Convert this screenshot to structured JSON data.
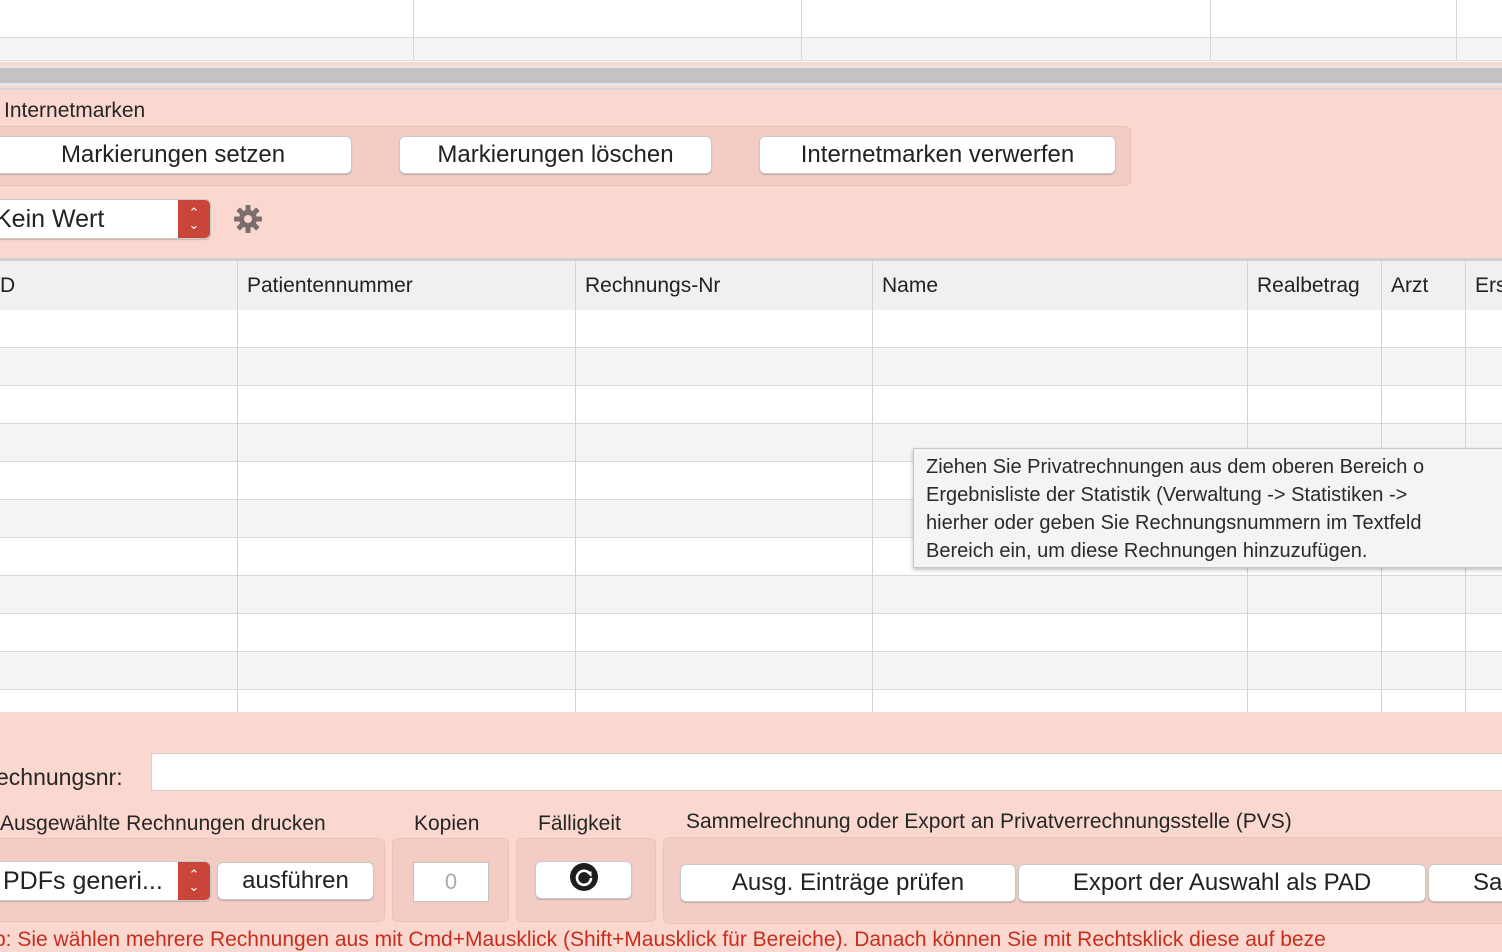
{
  "internetmarken": {
    "section_label": "Internetmarken",
    "set_button": "Markierungen setzen",
    "delete_button": "Markierungen löschen",
    "discard_button": "Internetmarken verwerfen"
  },
  "filter": {
    "selected": "Kein Wert"
  },
  "table": {
    "columns": [
      "D",
      "Patientennummer",
      "Rechnungs-Nr",
      "Name",
      "Realbetrag",
      "Arzt",
      "Ers"
    ]
  },
  "tooltip": {
    "lines": [
      "Ziehen Sie Privatrechnungen aus dem oberen Bereich o",
      "Ergebnisliste der Statistik (Verwaltung -> Statistiken ->",
      "hierher oder geben Sie Rechnungsnummern im Textfeld",
      "Bereich ein, um diese Rechnungen hinzuzufügen."
    ]
  },
  "rechnungsnr": {
    "label": "echnungsnr:",
    "value": ""
  },
  "print": {
    "group_label": "Ausgewählte Rechnungen drucken",
    "selected_option": "PDFs generi...",
    "run_button": "ausführen"
  },
  "kopien": {
    "label": "Kopien",
    "placeholder": "0"
  },
  "faelligkeit": {
    "label": "Fälligkeit"
  },
  "pvs": {
    "group_label": "Sammelrechnung oder Export an Privatverrechnungsstelle (PVS)",
    "check_button": "Ausg. Einträge prüfen",
    "export_button": "Export der Auswahl als PAD",
    "third_button": "Sa"
  },
  "hint": "p: Sie wählen mehrere Rechnungen aus mit Cmd+Mausklick (Shift+Mausklick für Bereiche). Danach können Sie mit Rechtsklick diese auf beze"
}
